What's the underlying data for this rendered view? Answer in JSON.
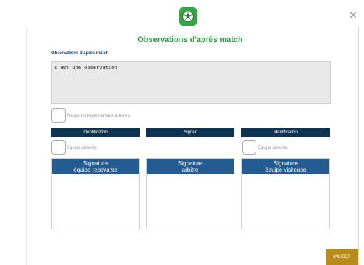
{
  "dialog": {
    "title": "Observations d'après match",
    "close_label": "×"
  },
  "observations": {
    "label": "Observations d'après match",
    "value": "c est une observation"
  },
  "rapport_checkbox": {
    "label": "Rapport complémentaire arbitre à",
    "checked": false
  },
  "columns": [
    {
      "button_label": "Identification",
      "absent_label": "Équipe absente",
      "signature_title_line1": "Signature",
      "signature_title_line2": "équipe recevante"
    },
    {
      "button_label": "Signer",
      "signature_title_line1": "Signature",
      "signature_title_line2": "arbitre"
    },
    {
      "button_label": "Identification",
      "absent_label": "Équipe absente",
      "signature_title_line1": "Signature",
      "signature_title_line2": "équipe visiteuse"
    }
  ],
  "footer": {
    "validate_label": "VALIDER"
  },
  "colors": {
    "brand_green": "#2e9e3f",
    "header_button": "#0f3451",
    "signature_header": "#245c91",
    "validate_button": "#b88a1b"
  },
  "icons": {
    "logo": "soccer-ball-icon",
    "close": "close-icon"
  }
}
